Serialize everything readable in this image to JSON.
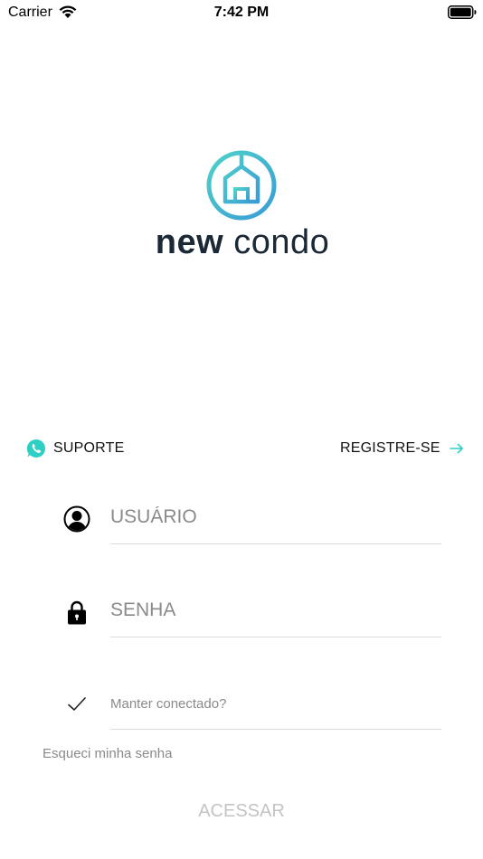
{
  "status_bar": {
    "carrier": "Carrier",
    "time": "7:42 PM"
  },
  "logo": {
    "word_bold": "new",
    "word_light": "condo",
    "colors": {
      "ring_start": "#4fd2c8",
      "ring_end": "#3a9bd6",
      "text": "#1b2836"
    }
  },
  "links": {
    "support_label": "SUPORTE",
    "support_icon": "whatsapp-icon",
    "register_label": "REGISTRE-SE",
    "register_icon": "arrow-right-icon"
  },
  "form": {
    "username": {
      "placeholder": "USUÁRIO",
      "value": "",
      "icon": "user-icon"
    },
    "password": {
      "placeholder": "SENHA",
      "value": "",
      "icon": "lock-icon"
    },
    "keep_connected": {
      "label": "Manter conectado?",
      "checked": true,
      "icon": "checkmark-icon"
    },
    "forgot_label": "Esqueci minha senha",
    "submit_label": "ACESSAR"
  },
  "colors": {
    "accent": "#2ecfc4",
    "placeholder": "#8a8a8a",
    "divider": "#dcdcdc",
    "disabled": "#c4c4c4"
  }
}
